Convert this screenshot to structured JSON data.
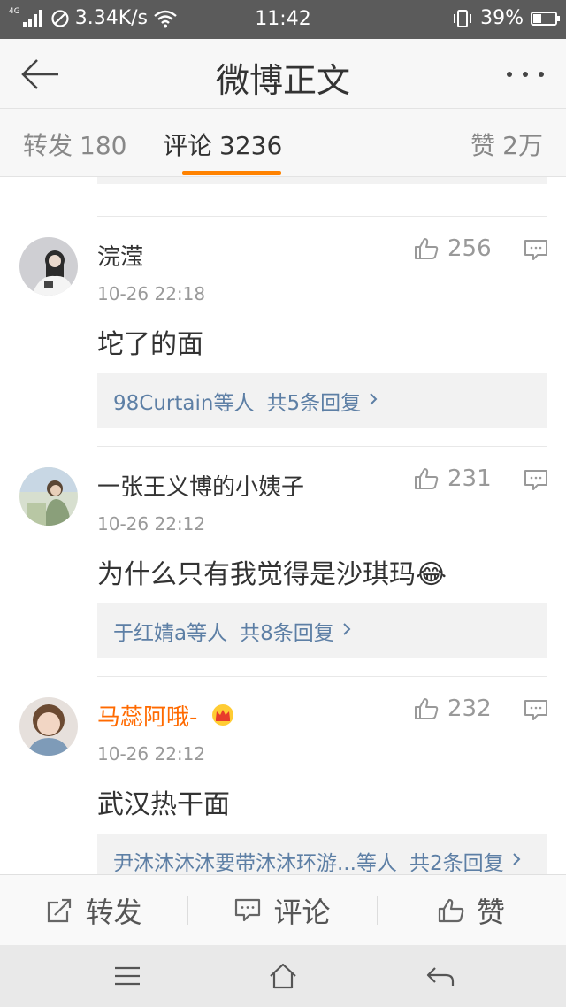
{
  "status_bar": {
    "network_type": "4G",
    "net_speed": "3.34K/s",
    "time": "11:42",
    "battery": "39%",
    "battery_level": 0.39
  },
  "title_bar": {
    "title": "微博正文"
  },
  "tabs": [
    {
      "label": "转发",
      "count": "180"
    },
    {
      "label": "评论",
      "count": "3236"
    },
    {
      "label": "赞",
      "count": "2万"
    }
  ],
  "colors": {
    "accent": "#ff8200",
    "link": "#5d7fa5",
    "vip_name": "#ff6a00"
  },
  "comments": [
    {
      "username": "浣滢",
      "time": "10-26 22:18",
      "likes": "256",
      "text": "坨了的面",
      "reply_users": "98Curtain等人",
      "reply_count": "共5条回复",
      "vip": false
    },
    {
      "username": "一张王义博的小姨子",
      "time": "10-26 22:12",
      "likes": "231",
      "text": "为什么只有我觉得是沙琪玛",
      "emoji": "😂",
      "reply_users": "于红婧a等人",
      "reply_count": "共8条回复",
      "vip": false
    },
    {
      "username": "马蕊阿哦-",
      "time": "10-26 22:12",
      "likes": "232",
      "text": "武汉热干面",
      "reply_users": "尹沐沐沐沐要带沐沐环游...等人",
      "reply_count": "共2条回复",
      "vip": true
    }
  ],
  "bottom_actions": [
    {
      "label": "转发",
      "icon": "share-icon"
    },
    {
      "label": "评论",
      "icon": "comment-icon"
    },
    {
      "label": "赞",
      "icon": "thumb-up-icon"
    }
  ],
  "system_nav": [
    {
      "icon": "menu-icon"
    },
    {
      "icon": "home-icon"
    },
    {
      "icon": "back-icon"
    }
  ]
}
